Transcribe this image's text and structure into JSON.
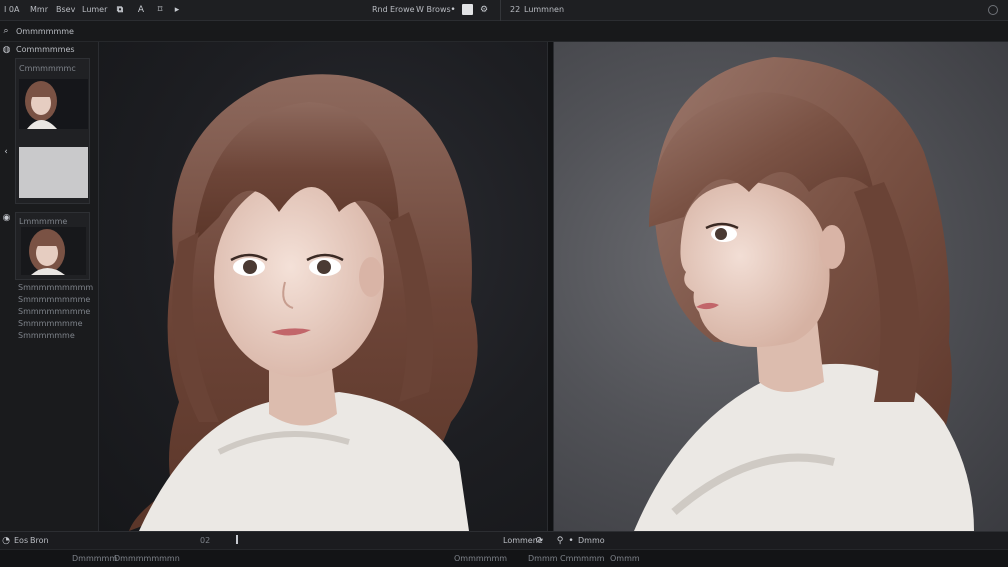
{
  "menu": {
    "items": [
      "I 0A",
      "Mmr",
      "Bsev",
      "Lumer"
    ],
    "icon_names": [
      "layers-icon",
      "text-icon",
      "crop-icon",
      "play-icon"
    ],
    "right_items": [
      "Rnd",
      "Erowe",
      "W Brows"
    ],
    "extra_label": "22",
    "extra_value": "Lummnen"
  },
  "toolbar": {
    "title": "Ommmmmme"
  },
  "sidebar": {
    "section_title": "Commmmmes",
    "panel1_title": "Cmmmmmmc",
    "panel2_title": "Lmmmmme",
    "text_lines": [
      "Smmmmmmmmm",
      "Smmmmmmmme",
      "Smmmmmmmme",
      "Smmmmmmme",
      "Smmmmmme"
    ]
  },
  "status": {
    "left_label": "Eos",
    "left_value": "Bron",
    "center_value": "02",
    "right_label": "Lommene",
    "right2": "Dmmo"
  },
  "bottom": {
    "items": [
      "Dmmmmm",
      "Dmmmmmmmn",
      "Ommmmmm",
      "Dmmm",
      "Cmmmmm",
      "Ommm"
    ]
  },
  "colors": {
    "accent": "#d7d9dd",
    "hair": "#7a5244",
    "skin": "#e8cfc4",
    "blouse": "#e9e6e3"
  }
}
